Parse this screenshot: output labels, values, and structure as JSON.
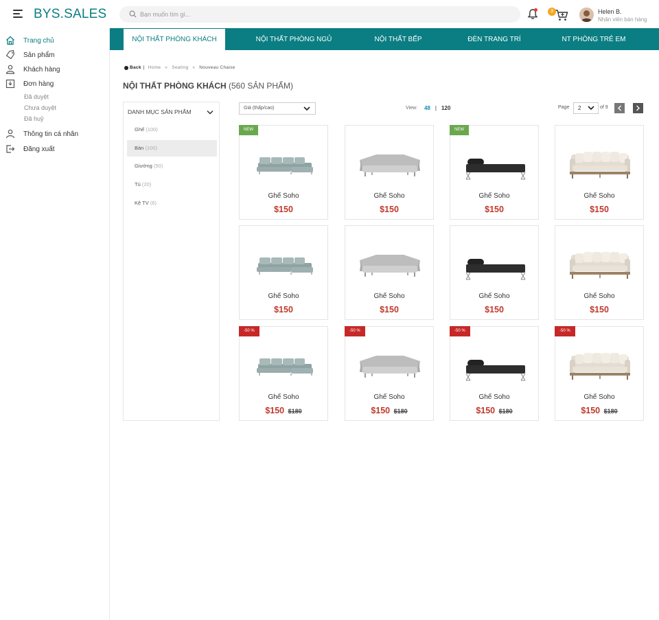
{
  "header": {
    "logo": "BYS.SALES",
    "search_placeholder": "Bạn muốn tìm gì...",
    "cart_count": "3",
    "user_name": "Helen B.",
    "user_role": "Nhân viên bán hàng"
  },
  "sidebar": {
    "items": [
      {
        "label": "Trang chủ",
        "icon": "home-icon"
      },
      {
        "label": "Sản phẩm",
        "icon": "tag-icon"
      },
      {
        "label": "Khách hàng",
        "icon": "user-icon"
      },
      {
        "label": "Đơn hàng",
        "icon": "inbox-icon"
      },
      {
        "label": "Thông tin cá nhân",
        "icon": "profile-icon"
      },
      {
        "label": "Đăng xuất",
        "icon": "logout-icon"
      }
    ],
    "order_subitems": [
      "Đã duyệt",
      "Chưa duyệt",
      "Đã huỷ"
    ]
  },
  "topnav": {
    "tabs": [
      "Nội thất phòng khách",
      "Nội thất phòng ngủ",
      "Nội thất bếp",
      "Đèn trang trí",
      "NT phòng trẻ em"
    ]
  },
  "breadcrumb": {
    "back": "Back",
    "items": [
      "Home",
      "Seating",
      "Nouveau Chaise"
    ]
  },
  "page": {
    "title": "NỘI THẤT PHÒNG KHÁCH",
    "count": "(560 SẢN PHẨM)"
  },
  "categories": {
    "heading": "Danh mục sản phẩm",
    "items": [
      {
        "name": "Ghế",
        "count": "(100)"
      },
      {
        "name": "Bàn",
        "count": "(100)"
      },
      {
        "name": "Giường",
        "count": "(50)"
      },
      {
        "name": "Tủ",
        "count": "(20)"
      },
      {
        "name": "Kệ TV",
        "count": "(6)"
      }
    ]
  },
  "toolbar": {
    "sort_value": "Giá (thấp/cao)",
    "view_label": "View:",
    "view_48": "48",
    "view_sep": "|",
    "view_120": "120",
    "page_label": "Page",
    "page_value": "2",
    "page_of": "of 9"
  },
  "products": {
    "name": "Ghế Soho",
    "price": "$150",
    "old_price": "$180",
    "badge_new": "NEW",
    "badge_sale": "-50 %"
  },
  "colors": {
    "brand": "#0a7e83",
    "price": "#c0392b",
    "badge_new": "#6aa84f",
    "badge_sale": "#c62828"
  }
}
